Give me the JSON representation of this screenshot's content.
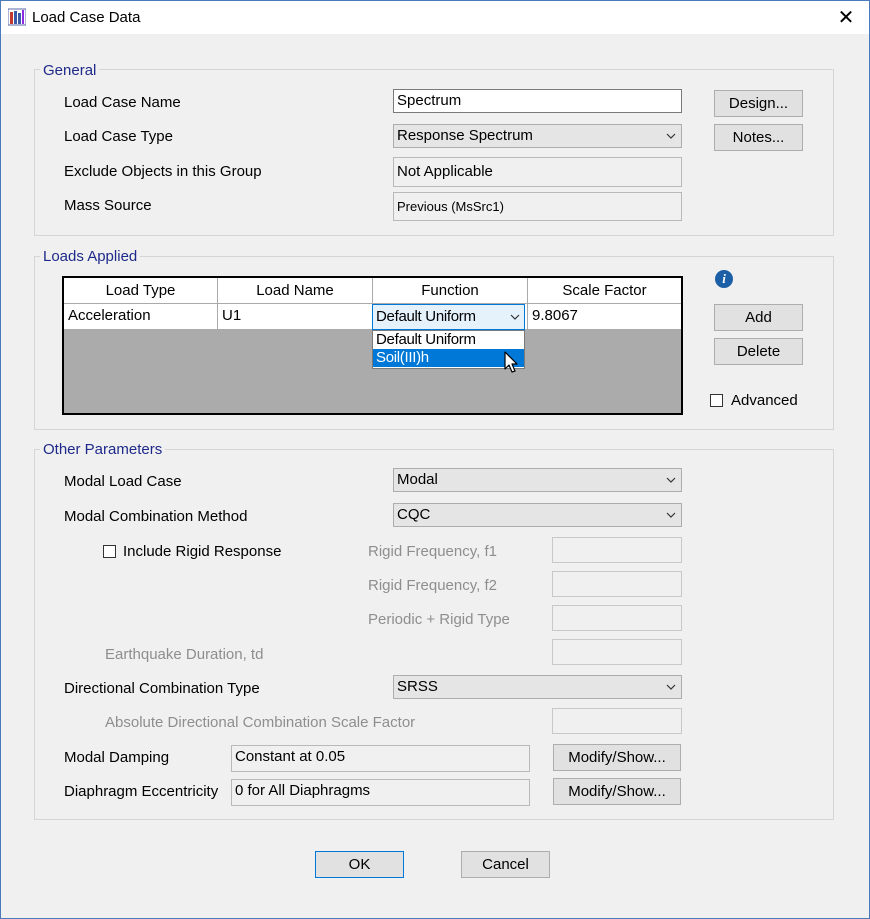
{
  "window": {
    "title": "Load Case Data",
    "close_glyph": "✕"
  },
  "general": {
    "title": "General",
    "load_case_name_label": "Load Case Name",
    "load_case_name_value": "Spectrum",
    "load_case_type_label": "Load Case Type",
    "load_case_type_value": "Response Spectrum",
    "exclude_label": "Exclude Objects in this Group",
    "exclude_value": "Not Applicable",
    "mass_source_label": "Mass Source",
    "mass_source_value": "Previous  (MsSrc1)",
    "design_button": "Design...",
    "notes_button": "Notes..."
  },
  "loads_applied": {
    "title": "Loads Applied",
    "columns": [
      "Load Type",
      "Load Name",
      "Function",
      "Scale Factor"
    ],
    "rows": [
      {
        "load_type": "Acceleration",
        "load_name": "U1",
        "function": "Default Uniform",
        "scale_factor": "9.8067"
      }
    ],
    "function_options": [
      "Default Uniform",
      "Soil(III)h"
    ],
    "function_highlighted": "Soil(III)h",
    "info_glyph": "i",
    "add_button": "Add",
    "delete_button": "Delete",
    "advanced_label": "Advanced",
    "advanced_checked": false
  },
  "other": {
    "title": "Other Parameters",
    "modal_load_case_label": "Modal Load Case",
    "modal_load_case_value": "Modal",
    "modal_comb_label": "Modal Combination Method",
    "modal_comb_value": "CQC",
    "include_rigid_label": "Include Rigid Response",
    "include_rigid_checked": false,
    "rigid_f1_label": "Rigid Frequency, f1",
    "rigid_f2_label": "Rigid Frequency, f2",
    "periodic_label": "Periodic + Rigid Type",
    "eq_duration_label": "Earthquake Duration, td",
    "dir_comb_label": "Directional Combination Type",
    "dir_comb_value": "SRSS",
    "abs_dir_label": "Absolute Directional Combination Scale Factor",
    "modal_damping_label": "Modal Damping",
    "modal_damping_value": "Constant at 0.05",
    "diaphragm_label": "Diaphragm Eccentricity",
    "diaphragm_value": "0 for All Diaphragms",
    "modify_button": "Modify/Show..."
  },
  "footer": {
    "ok_button": "OK",
    "cancel_button": "Cancel"
  },
  "colors": {
    "group_title": "#1e2a8a",
    "highlight": "#0078d7",
    "window_border": "#4a7ab8"
  }
}
